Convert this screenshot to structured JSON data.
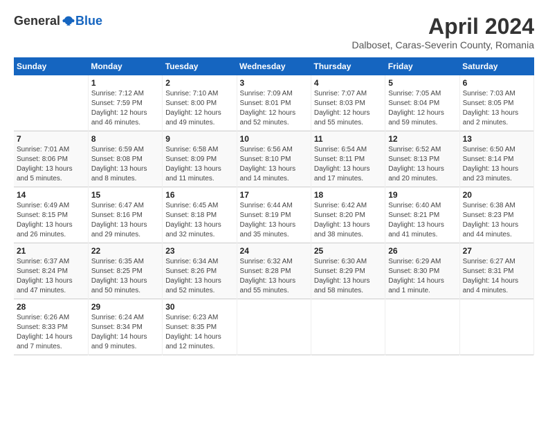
{
  "logo": {
    "general": "General",
    "blue": "Blue"
  },
  "title": {
    "month_year": "April 2024",
    "location": "Dalboset, Caras-Severin County, Romania"
  },
  "weekdays": [
    "Sunday",
    "Monday",
    "Tuesday",
    "Wednesday",
    "Thursday",
    "Friday",
    "Saturday"
  ],
  "weeks": [
    [
      {
        "day": "",
        "sunrise": "",
        "sunset": "",
        "daylight": ""
      },
      {
        "day": "1",
        "sunrise": "Sunrise: 7:12 AM",
        "sunset": "Sunset: 7:59 PM",
        "daylight": "Daylight: 12 hours and 46 minutes."
      },
      {
        "day": "2",
        "sunrise": "Sunrise: 7:10 AM",
        "sunset": "Sunset: 8:00 PM",
        "daylight": "Daylight: 12 hours and 49 minutes."
      },
      {
        "day": "3",
        "sunrise": "Sunrise: 7:09 AM",
        "sunset": "Sunset: 8:01 PM",
        "daylight": "Daylight: 12 hours and 52 minutes."
      },
      {
        "day": "4",
        "sunrise": "Sunrise: 7:07 AM",
        "sunset": "Sunset: 8:03 PM",
        "daylight": "Daylight: 12 hours and 55 minutes."
      },
      {
        "day": "5",
        "sunrise": "Sunrise: 7:05 AM",
        "sunset": "Sunset: 8:04 PM",
        "daylight": "Daylight: 12 hours and 59 minutes."
      },
      {
        "day": "6",
        "sunrise": "Sunrise: 7:03 AM",
        "sunset": "Sunset: 8:05 PM",
        "daylight": "Daylight: 13 hours and 2 minutes."
      }
    ],
    [
      {
        "day": "7",
        "sunrise": "Sunrise: 7:01 AM",
        "sunset": "Sunset: 8:06 PM",
        "daylight": "Daylight: 13 hours and 5 minutes."
      },
      {
        "day": "8",
        "sunrise": "Sunrise: 6:59 AM",
        "sunset": "Sunset: 8:08 PM",
        "daylight": "Daylight: 13 hours and 8 minutes."
      },
      {
        "day": "9",
        "sunrise": "Sunrise: 6:58 AM",
        "sunset": "Sunset: 8:09 PM",
        "daylight": "Daylight: 13 hours and 11 minutes."
      },
      {
        "day": "10",
        "sunrise": "Sunrise: 6:56 AM",
        "sunset": "Sunset: 8:10 PM",
        "daylight": "Daylight: 13 hours and 14 minutes."
      },
      {
        "day": "11",
        "sunrise": "Sunrise: 6:54 AM",
        "sunset": "Sunset: 8:11 PM",
        "daylight": "Daylight: 13 hours and 17 minutes."
      },
      {
        "day": "12",
        "sunrise": "Sunrise: 6:52 AM",
        "sunset": "Sunset: 8:13 PM",
        "daylight": "Daylight: 13 hours and 20 minutes."
      },
      {
        "day": "13",
        "sunrise": "Sunrise: 6:50 AM",
        "sunset": "Sunset: 8:14 PM",
        "daylight": "Daylight: 13 hours and 23 minutes."
      }
    ],
    [
      {
        "day": "14",
        "sunrise": "Sunrise: 6:49 AM",
        "sunset": "Sunset: 8:15 PM",
        "daylight": "Daylight: 13 hours and 26 minutes."
      },
      {
        "day": "15",
        "sunrise": "Sunrise: 6:47 AM",
        "sunset": "Sunset: 8:16 PM",
        "daylight": "Daylight: 13 hours and 29 minutes."
      },
      {
        "day": "16",
        "sunrise": "Sunrise: 6:45 AM",
        "sunset": "Sunset: 8:18 PM",
        "daylight": "Daylight: 13 hours and 32 minutes."
      },
      {
        "day": "17",
        "sunrise": "Sunrise: 6:44 AM",
        "sunset": "Sunset: 8:19 PM",
        "daylight": "Daylight: 13 hours and 35 minutes."
      },
      {
        "day": "18",
        "sunrise": "Sunrise: 6:42 AM",
        "sunset": "Sunset: 8:20 PM",
        "daylight": "Daylight: 13 hours and 38 minutes."
      },
      {
        "day": "19",
        "sunrise": "Sunrise: 6:40 AM",
        "sunset": "Sunset: 8:21 PM",
        "daylight": "Daylight: 13 hours and 41 minutes."
      },
      {
        "day": "20",
        "sunrise": "Sunrise: 6:38 AM",
        "sunset": "Sunset: 8:23 PM",
        "daylight": "Daylight: 13 hours and 44 minutes."
      }
    ],
    [
      {
        "day": "21",
        "sunrise": "Sunrise: 6:37 AM",
        "sunset": "Sunset: 8:24 PM",
        "daylight": "Daylight: 13 hours and 47 minutes."
      },
      {
        "day": "22",
        "sunrise": "Sunrise: 6:35 AM",
        "sunset": "Sunset: 8:25 PM",
        "daylight": "Daylight: 13 hours and 50 minutes."
      },
      {
        "day": "23",
        "sunrise": "Sunrise: 6:34 AM",
        "sunset": "Sunset: 8:26 PM",
        "daylight": "Daylight: 13 hours and 52 minutes."
      },
      {
        "day": "24",
        "sunrise": "Sunrise: 6:32 AM",
        "sunset": "Sunset: 8:28 PM",
        "daylight": "Daylight: 13 hours and 55 minutes."
      },
      {
        "day": "25",
        "sunrise": "Sunrise: 6:30 AM",
        "sunset": "Sunset: 8:29 PM",
        "daylight": "Daylight: 13 hours and 58 minutes."
      },
      {
        "day": "26",
        "sunrise": "Sunrise: 6:29 AM",
        "sunset": "Sunset: 8:30 PM",
        "daylight": "Daylight: 14 hours and 1 minute."
      },
      {
        "day": "27",
        "sunrise": "Sunrise: 6:27 AM",
        "sunset": "Sunset: 8:31 PM",
        "daylight": "Daylight: 14 hours and 4 minutes."
      }
    ],
    [
      {
        "day": "28",
        "sunrise": "Sunrise: 6:26 AM",
        "sunset": "Sunset: 8:33 PM",
        "daylight": "Daylight: 14 hours and 7 minutes."
      },
      {
        "day": "29",
        "sunrise": "Sunrise: 6:24 AM",
        "sunset": "Sunset: 8:34 PM",
        "daylight": "Daylight: 14 hours and 9 minutes."
      },
      {
        "day": "30",
        "sunrise": "Sunrise: 6:23 AM",
        "sunset": "Sunset: 8:35 PM",
        "daylight": "Daylight: 14 hours and 12 minutes."
      },
      {
        "day": "",
        "sunrise": "",
        "sunset": "",
        "daylight": ""
      },
      {
        "day": "",
        "sunrise": "",
        "sunset": "",
        "daylight": ""
      },
      {
        "day": "",
        "sunrise": "",
        "sunset": "",
        "daylight": ""
      },
      {
        "day": "",
        "sunrise": "",
        "sunset": "",
        "daylight": ""
      }
    ]
  ]
}
